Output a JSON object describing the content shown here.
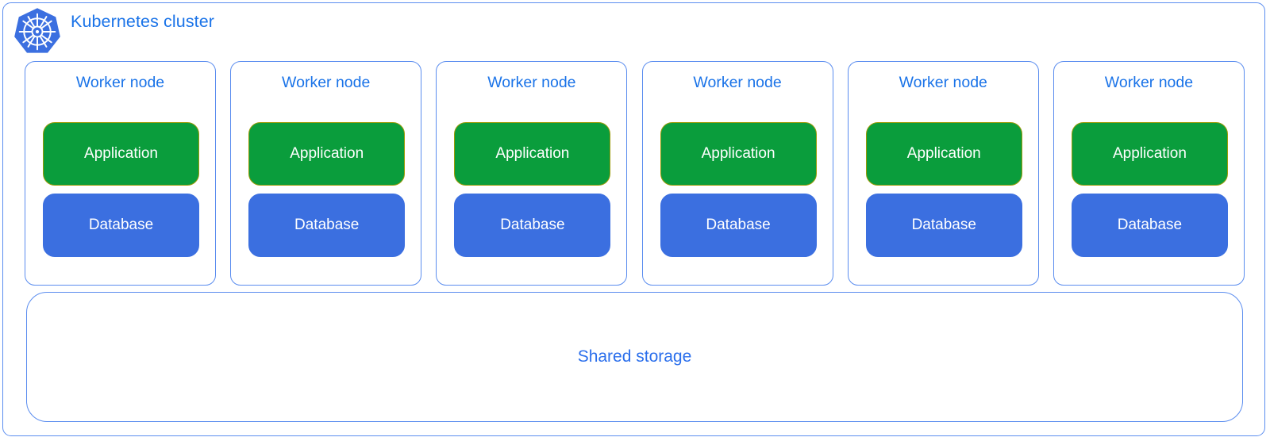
{
  "cluster": {
    "title": "Kubernetes cluster",
    "logo_icon": "kubernetes-logo-icon",
    "border_color": "#5B8DEF",
    "title_color": "#1A73E8"
  },
  "worker_nodes": [
    {
      "title": "Worker node",
      "application": {
        "label": "Application",
        "color": "#0A9D3C",
        "border_color": "#9A9B07"
      },
      "database": {
        "label": "Database",
        "color": "#3B6FE0"
      }
    },
    {
      "title": "Worker node",
      "application": {
        "label": "Application",
        "color": "#0A9D3C",
        "border_color": "#9A9B07"
      },
      "database": {
        "label": "Database",
        "color": "#3B6FE0"
      }
    },
    {
      "title": "Worker node",
      "application": {
        "label": "Application",
        "color": "#0A9D3C",
        "border_color": "#9A9B07"
      },
      "database": {
        "label": "Database",
        "color": "#3B6FE0"
      }
    },
    {
      "title": "Worker node",
      "application": {
        "label": "Application",
        "color": "#0A9D3C",
        "border_color": "#9A9B07"
      },
      "database": {
        "label": "Database",
        "color": "#3B6FE0"
      }
    },
    {
      "title": "Worker node",
      "application": {
        "label": "Application",
        "color": "#0A9D3C",
        "border_color": "#9A9B07"
      },
      "database": {
        "label": "Database",
        "color": "#3B6FE0"
      }
    },
    {
      "title": "Worker node",
      "application": {
        "label": "Application",
        "color": "#0A9D3C",
        "border_color": "#9A9B07"
      },
      "database": {
        "label": "Database",
        "color": "#3B6FE0"
      }
    }
  ],
  "shared_storage": {
    "label": "Shared storage",
    "label_color": "#2B6FEC",
    "border_color": "#5B8DEF"
  }
}
